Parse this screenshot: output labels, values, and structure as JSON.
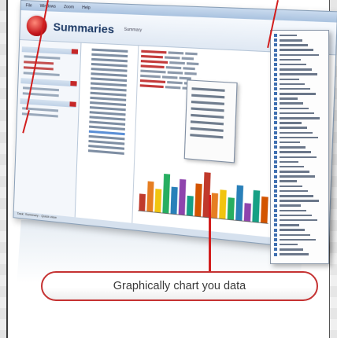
{
  "app": {
    "title": "Summaries",
    "menu": [
      "File",
      "Windows",
      "Zoom",
      "Help"
    ],
    "header_sub": "Summary",
    "status": "Task: Summary - Quick view"
  },
  "caption": {
    "text": "Graphically chart you data"
  },
  "colors": {
    "accent_red": "#d21e1e",
    "pill_border": "#c53232",
    "app_blue": "#1d3a66"
  },
  "chart_bars": [
    0.35,
    0.62,
    0.48,
    0.8,
    0.55,
    0.72,
    0.4,
    0.66,
    0.9,
    0.5,
    0.58,
    0.44,
    0.7,
    0.36,
    0.63,
    0.52
  ],
  "dropdown_rows": 46
}
